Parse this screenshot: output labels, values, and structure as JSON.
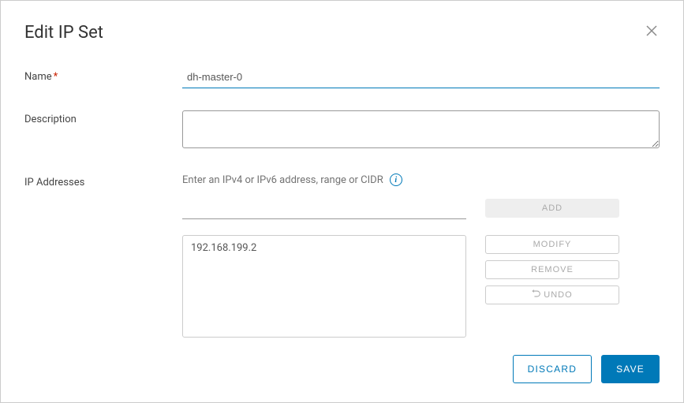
{
  "dialog": {
    "title": "Edit IP Set"
  },
  "form": {
    "name": {
      "label": "Name",
      "value": "dh-master-0"
    },
    "description": {
      "label": "Description",
      "value": ""
    },
    "ipAddresses": {
      "label": "IP Addresses",
      "hint": "Enter an IPv4 or IPv6 address, range or CIDR",
      "inputValue": "",
      "list": [
        "192.168.199.2"
      ]
    }
  },
  "buttons": {
    "add": "ADD",
    "modify": "MODIFY",
    "remove": "REMOVE",
    "undo": "UNDO",
    "discard": "DISCARD",
    "save": "SAVE"
  }
}
